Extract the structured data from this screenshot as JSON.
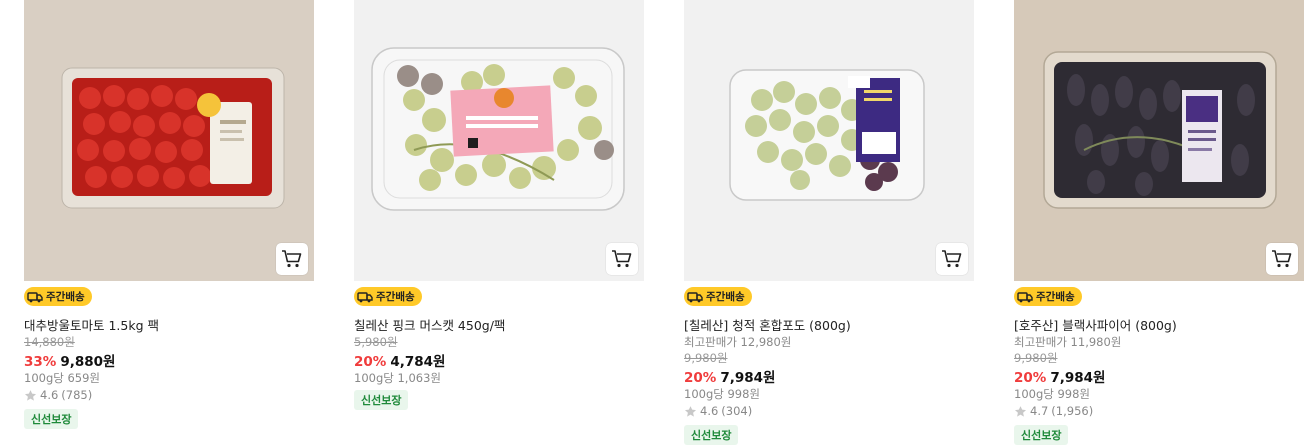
{
  "colors": {
    "discount": "#f03c3c",
    "delivery_badge_bg": "#ffc928",
    "fresh_badge_bg": "#e9f6ec",
    "fresh_badge_text": "#1f8a3a",
    "star": "#c8c8c8"
  },
  "products": [
    {
      "image_alt": "대추방울토마토",
      "delivery_badge": "주간배송",
      "title": "대추방울토마토 1.5kg 팩",
      "original_price": "14,880원",
      "discount": "33%",
      "price": "9,880원",
      "unit_price": "100g당 659원",
      "rating": "4.6",
      "reviews": "(785)",
      "fresh_badge": "신선보장",
      "cart_icon": "cart-icon",
      "image_colors": [
        "#d8cdc1",
        "#cc2b21"
      ]
    },
    {
      "image_alt": "칠레산 핑크 머스캣",
      "delivery_badge": "주간배송",
      "title": "칠레산 핑크 머스캣 450g/팩",
      "original_price": "5,980원",
      "discount": "20%",
      "price": "4,784원",
      "unit_price": "100g당 1,063원",
      "fresh_badge": "신선보장",
      "cart_icon": "cart-icon",
      "image_colors": [
        "#f1f1f1",
        "#c9cf8e"
      ]
    },
    {
      "image_alt": "칠레산 청적 혼합포도",
      "delivery_badge": "주간배송",
      "title": "[칠레산] 청적 혼합포도 (800g)",
      "best_price": "최고판매가 12,980원",
      "original_price": "9,980원",
      "discount": "20%",
      "price": "7,984원",
      "unit_price": "100g당 998원",
      "rating": "4.6",
      "reviews": "(304)",
      "fresh_badge": "신선보장",
      "cart_icon": "cart-icon",
      "image_colors": [
        "#f1f1f1",
        "#c5cf98"
      ]
    },
    {
      "image_alt": "호주산 블랙사파이어",
      "delivery_badge": "주간배송",
      "title": "[호주산] 블랙사파이어 (800g)",
      "best_price": "최고판매가 11,980원",
      "original_price": "9,980원",
      "discount": "20%",
      "price": "7,984원",
      "unit_price": "100g당 998원",
      "rating": "4.7",
      "reviews": "(1,956)",
      "fresh_badge": "신선보장",
      "cart_icon": "cart-icon",
      "image_colors": [
        "#d5c8b8",
        "#2a2730"
      ]
    }
  ]
}
